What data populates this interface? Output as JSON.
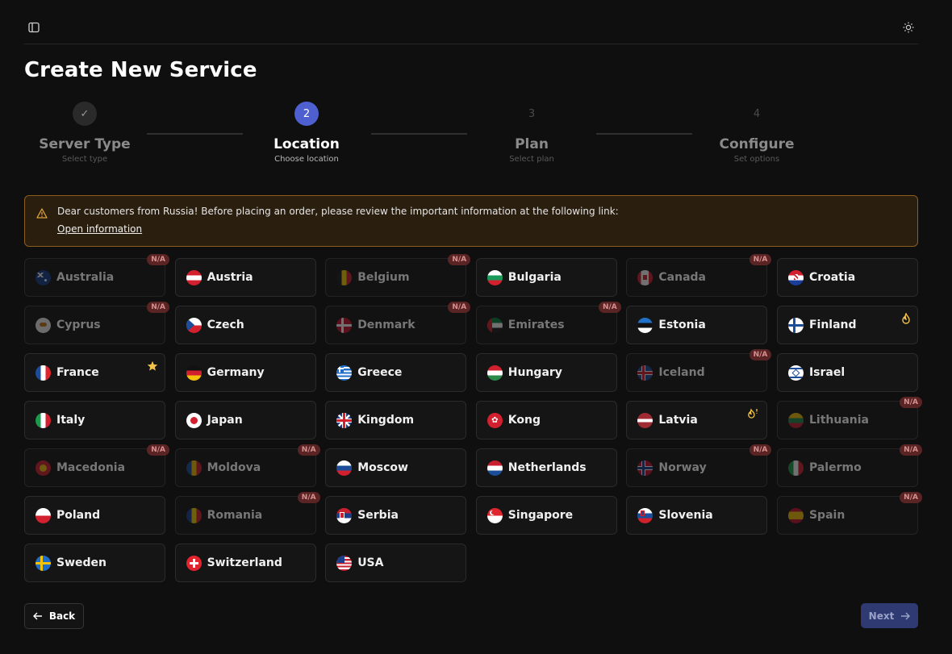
{
  "page": {
    "title": "Create New Service"
  },
  "steps": [
    {
      "num": "✓",
      "name": "Server Type",
      "sub": "Select type",
      "state": "done"
    },
    {
      "num": "2",
      "name": "Location",
      "sub": "Choose location",
      "state": "active"
    },
    {
      "num": "3",
      "name": "Plan",
      "sub": "Select plan",
      "state": "todo"
    },
    {
      "num": "4",
      "name": "Configure",
      "sub": "Set options",
      "state": "todo"
    }
  ],
  "alert": {
    "message": "Dear customers from Russia! Before placing an order, please review the important information at the following link:",
    "link": "Open information"
  },
  "locations": [
    {
      "name": "Australia",
      "badge": "N/A",
      "flag": "australia"
    },
    {
      "name": "Austria",
      "flag": "austria"
    },
    {
      "name": "Belgium",
      "badge": "N/A",
      "flag": "belgium"
    },
    {
      "name": "Bulgaria",
      "flag": "bulgaria"
    },
    {
      "name": "Canada",
      "badge": "N/A",
      "flag": "canada"
    },
    {
      "name": "Croatia",
      "flag": "croatia"
    },
    {
      "name": "Cyprus",
      "badge": "N/A",
      "flag": "cyprus"
    },
    {
      "name": "Czech",
      "flag": "czech"
    },
    {
      "name": "Denmark",
      "badge": "N/A",
      "flag": "denmark"
    },
    {
      "name": "Emirates",
      "badge": "N/A",
      "flag": "emirates"
    },
    {
      "name": "Estonia",
      "flag": "estonia"
    },
    {
      "name": "Finland",
      "mark": "fire-icon",
      "flag": "finland"
    },
    {
      "name": "France",
      "mark": "star-icon",
      "flag": "france"
    },
    {
      "name": "Germany",
      "flag": "germany"
    },
    {
      "name": "Greece",
      "flag": "greece"
    },
    {
      "name": "Hungary",
      "flag": "hungary"
    },
    {
      "name": "Iceland",
      "badge": "N/A",
      "flag": "iceland"
    },
    {
      "name": "Israel",
      "flag": "israel"
    },
    {
      "name": "Italy",
      "flag": "italy"
    },
    {
      "name": "Japan",
      "flag": "japan"
    },
    {
      "name": "Kingdom",
      "flag": "kingdom"
    },
    {
      "name": "Kong",
      "flag": "kong"
    },
    {
      "name": "Latvia",
      "mark": "new-icon",
      "flag": "latvia"
    },
    {
      "name": "Lithuania",
      "badge": "N/A",
      "flag": "lithuania"
    },
    {
      "name": "Macedonia",
      "badge": "N/A",
      "flag": "macedonia"
    },
    {
      "name": "Moldova",
      "badge": "N/A",
      "flag": "moldova"
    },
    {
      "name": "Moscow",
      "flag": "moscow"
    },
    {
      "name": "Netherlands",
      "flag": "netherlands"
    },
    {
      "name": "Norway",
      "badge": "N/A",
      "flag": "norway"
    },
    {
      "name": "Palermo",
      "badge": "N/A",
      "flag": "palermo"
    },
    {
      "name": "Poland",
      "flag": "poland"
    },
    {
      "name": "Romania",
      "badge": "N/A",
      "flag": "romania"
    },
    {
      "name": "Serbia",
      "flag": "serbia"
    },
    {
      "name": "Singapore",
      "flag": "singapore"
    },
    {
      "name": "Slovenia",
      "flag": "slovenia"
    },
    {
      "name": "Spain",
      "badge": "N/A",
      "flag": "spain"
    },
    {
      "name": "Sweden",
      "flag": "sweden"
    },
    {
      "name": "Switzerland",
      "flag": "switzerland"
    },
    {
      "name": "USA",
      "flag": "usa"
    }
  ],
  "buttons": {
    "back": "Back",
    "next": "Next"
  },
  "colors": {
    "accent": "#4e5fcf",
    "na_badge": "#5b2424",
    "alert_border": "#8c5e1d"
  }
}
